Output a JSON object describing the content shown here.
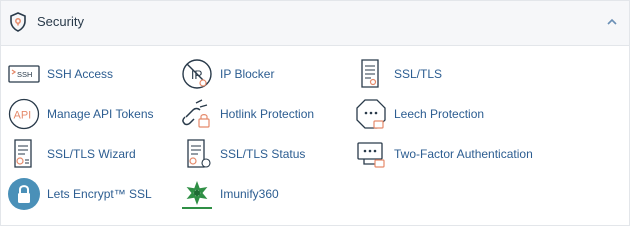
{
  "section": {
    "title": "Security",
    "icon": "shield-icon",
    "toggle_icon": "chevron-up-icon"
  },
  "items": [
    {
      "label": "SSH Access",
      "icon": "ssh-terminal-icon"
    },
    {
      "label": "IP Blocker",
      "icon": "ip-blocker-icon"
    },
    {
      "label": "SSL/TLS",
      "icon": "certificate-icon"
    },
    {
      "label": "Manage API Tokens",
      "icon": "api-icon"
    },
    {
      "label": "Hotlink Protection",
      "icon": "hotlink-icon"
    },
    {
      "label": "Leech Protection",
      "icon": "leech-icon"
    },
    {
      "label": "SSL/TLS Wizard",
      "icon": "ssl-wizard-icon"
    },
    {
      "label": "SSL/TLS Status",
      "icon": "ssl-status-icon"
    },
    {
      "label": "Two-Factor Authentication",
      "icon": "two-factor-icon"
    },
    {
      "label": "Lets Encrypt™ SSL",
      "icon": "lets-encrypt-icon"
    },
    {
      "label": "Imunify360",
      "icon": "imunify360-icon"
    }
  ],
  "colors": {
    "link": "#2c5d91",
    "icon_stroke": "#293a4a",
    "lock_accent": "#e58a6b",
    "header_bg": "#f6f7f9",
    "lets_encrypt_bg": "#4a90b8",
    "imunify_green": "#2f8f45"
  },
  "ssh_icon_text": "SSH",
  "api_icon_text": "API",
  "ip_icon_text": "IP"
}
